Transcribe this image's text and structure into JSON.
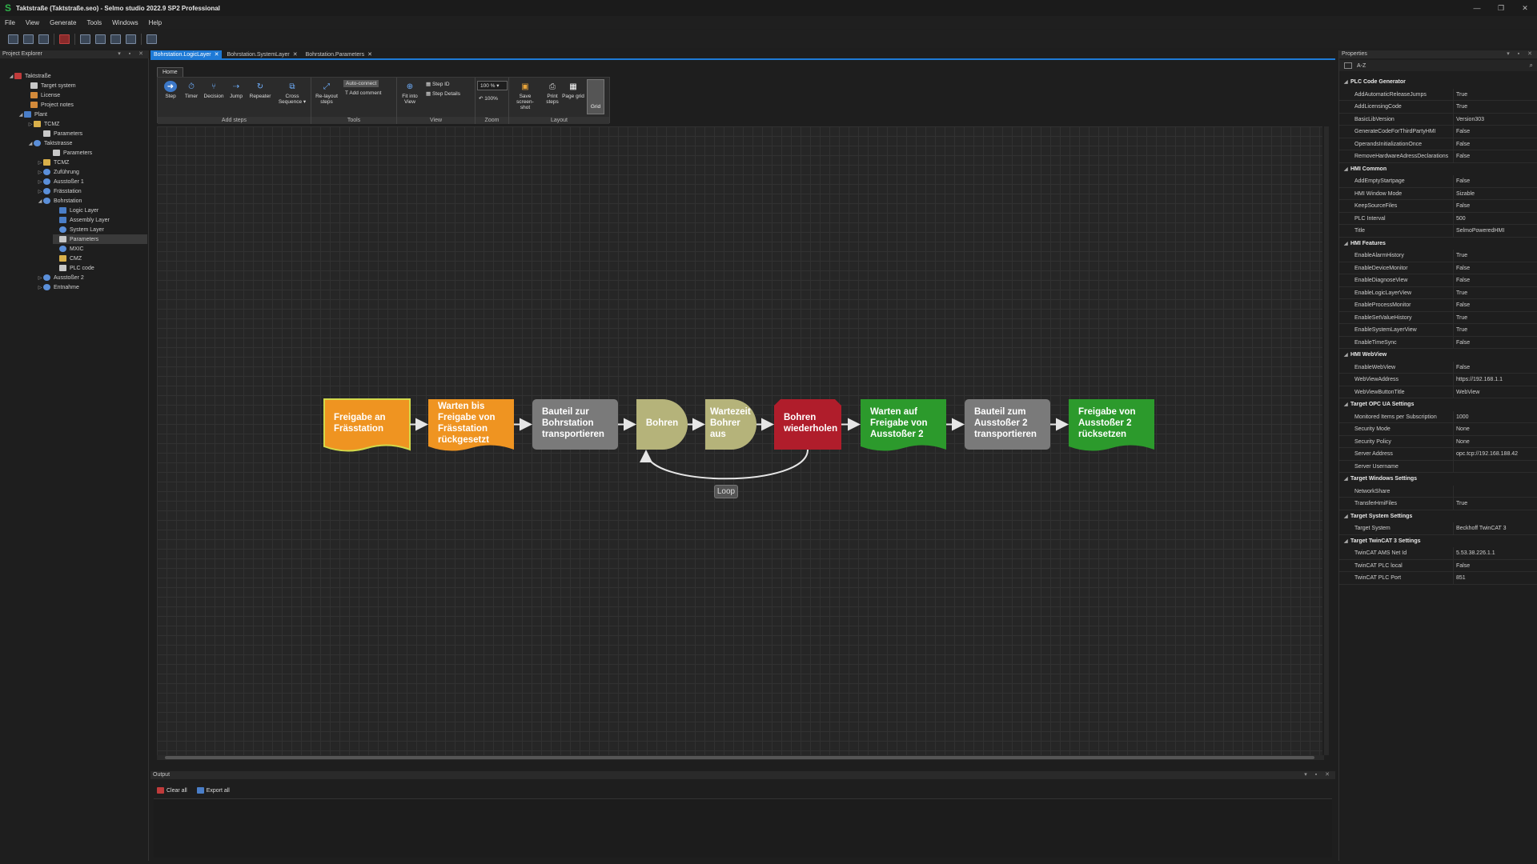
{
  "window": {
    "title": "Taktstraße (Taktstraße.seo) - Selmo studio 2022.9 SP2 Professional",
    "logo": "S",
    "buttons": [
      "—",
      "❐",
      "✕"
    ]
  },
  "menu": [
    "File",
    "View",
    "Generate",
    "Tools",
    "Windows",
    "Help"
  ],
  "explorer": {
    "title": "Project Explorer",
    "items": [
      {
        "label": "Taktstraße",
        "arrow": "◢",
        "icon": "red"
      },
      {
        "label": "Target system",
        "arrow": "",
        "icon": "doc"
      },
      {
        "label": "License",
        "arrow": "",
        "icon": "orange"
      },
      {
        "label": "Project notes",
        "arrow": "",
        "icon": "orange"
      },
      {
        "label": "Plant",
        "arrow": "◢",
        "icon": "blue"
      },
      {
        "label": "TCMZ",
        "arrow": "▷",
        "icon": "folder"
      },
      {
        "label": "Parameters",
        "arrow": "",
        "icon": "doc"
      },
      {
        "label": "Taktstrasse",
        "arrow": "◢",
        "icon": "globe"
      },
      {
        "label": "Parameters",
        "arrow": "",
        "icon": "doc"
      },
      {
        "label": "TCMZ",
        "arrow": "▷",
        "icon": "folder"
      },
      {
        "label": "Zuführung",
        "arrow": "▷",
        "icon": "globe"
      },
      {
        "label": "Ausstoßer 1",
        "arrow": "▷",
        "icon": "globe"
      },
      {
        "label": "Frässtation",
        "arrow": "▷",
        "icon": "globe"
      },
      {
        "label": "Bohrstation",
        "arrow": "◢",
        "icon": "globe"
      },
      {
        "label": "Logic Layer",
        "arrow": "",
        "icon": "blue"
      },
      {
        "label": "Assembly Layer",
        "arrow": "",
        "icon": "blue"
      },
      {
        "label": "System Layer",
        "arrow": "",
        "icon": "globe"
      },
      {
        "label": "Parameters",
        "arrow": "",
        "icon": "doc"
      },
      {
        "label": "MXIC",
        "arrow": "",
        "icon": "globe"
      },
      {
        "label": "CMZ",
        "arrow": "",
        "icon": "folder"
      },
      {
        "label": "PLC code",
        "arrow": "",
        "icon": "doc"
      },
      {
        "label": "Ausstoßer 2",
        "arrow": "▷",
        "icon": "globe"
      },
      {
        "label": "Entnahme",
        "arrow": "▷",
        "icon": "globe"
      }
    ]
  },
  "tabs": [
    {
      "label": "Bohrstation.LogicLayer",
      "active": true
    },
    {
      "label": "Bohrstation.SystemLayer",
      "active": false
    },
    {
      "label": "Bohrstation.Parameters",
      "active": false
    }
  ],
  "ribbon": {
    "tab": "Home",
    "add_steps": {
      "group": "Add steps",
      "step": "Step",
      "timer": "Timer",
      "decision": "Decision",
      "jump": "Jump",
      "repeater": "Repeater",
      "cross_sequence": "Cross Sequence ▾"
    },
    "tools": {
      "group": "Tools",
      "relayout": "Re-layout steps",
      "auto_connect": "Auto-connect",
      "add_comment": "Add comment"
    },
    "view": {
      "group": "View",
      "fit": "Fit into View",
      "step_id": "Step ID",
      "step_details": "Step Details"
    },
    "zoom": {
      "group": "Zoom",
      "value": "100 %",
      "reset": "100%"
    },
    "layout": {
      "group": "Layout",
      "save": "Save screen-shot",
      "print": "Print steps",
      "page": "Page grid",
      "grid": "Grid"
    }
  },
  "flow": {
    "steps": [
      {
        "label": "Freigabe an\nFrässtation",
        "color": "#ef9421",
        "shape": "doc",
        "border": "#d2d94a"
      },
      {
        "label": "Warten bis\nFreigabe von\nFrässtation\nrückgesetzt",
        "color": "#ef9421",
        "shape": "doc",
        "border": ""
      },
      {
        "label": "Bauteil zur\nBohrstation\ntransportieren",
        "color": "#7a7a7a",
        "shape": "rounded",
        "border": ""
      },
      {
        "label": "Bohren",
        "color": "#b5b37a",
        "shape": "half-round",
        "border": ""
      },
      {
        "label": "Wartezeit\nBohrer\naus",
        "color": "#b5b37a",
        "shape": "half-round",
        "border": ""
      },
      {
        "label": "Bohren\nwiederholen",
        "color": "#b01d2b",
        "shape": "octagon",
        "border": ""
      },
      {
        "label": "Warten auf\nFreigabe von\nAusstoßer 2",
        "color": "#2c9a2c",
        "shape": "doc",
        "border": ""
      },
      {
        "label": "Bauteil zum\nAusstoßer 2\ntransportieren",
        "color": "#7a7a7a",
        "shape": "rounded",
        "border": ""
      },
      {
        "label": "Freigabe von\nAusstoßer 2\nrücksetzen",
        "color": "#2c9a2c",
        "shape": "doc",
        "border": ""
      }
    ],
    "loop_label": "Loop"
  },
  "output": {
    "title": "Output",
    "clear_all": "Clear all",
    "export_all": "Export all"
  },
  "properties": {
    "title": "Properties",
    "sort_label": "A-Z",
    "sections": [
      {
        "name": "PLC Code Generator",
        "rows": [
          [
            "AddAutomaticReleaseJumps",
            "True"
          ],
          [
            "AddLicensingCode",
            "True"
          ],
          [
            "BasicLibVersion",
            "Version303"
          ],
          [
            "GenerateCodeForThirdPartyHMI",
            "False"
          ],
          [
            "OperandsInitializationOnce",
            "False"
          ],
          [
            "RemoveHardwareAdressDeclarations",
            "False"
          ]
        ]
      },
      {
        "name": "HMI Common",
        "rows": [
          [
            "AddEmptyStartpage",
            "False"
          ],
          [
            "HMI Window Mode",
            "Sizable"
          ],
          [
            "KeepSourceFiles",
            "False"
          ],
          [
            "PLC Interval",
            "500"
          ],
          [
            "Title",
            "SelmoPoweredHMI"
          ]
        ]
      },
      {
        "name": "HMI Features",
        "rows": [
          [
            "EnableAlarmHistory",
            "True"
          ],
          [
            "EnableDeviceMonitor",
            "False"
          ],
          [
            "EnableDiagnoseView",
            "False"
          ],
          [
            "EnableLogicLayerView",
            "True"
          ],
          [
            "EnableProcessMonitor",
            "False"
          ],
          [
            "EnableSetValueHistory",
            "True"
          ],
          [
            "EnableSystemLayerView",
            "True"
          ],
          [
            "EnableTimeSync",
            "False"
          ]
        ]
      },
      {
        "name": "HMI WebView",
        "rows": [
          [
            "EnableWebView",
            "False"
          ],
          [
            "WebViewAddress",
            "https://192.168.1.1"
          ],
          [
            "WebViewButtonTitle",
            "WebView"
          ]
        ]
      },
      {
        "name": "Target OPC UA Settings",
        "rows": [
          [
            "Monitored Items per Subscription",
            "1000"
          ],
          [
            "Security Mode",
            "None"
          ],
          [
            "Security Policy",
            "None"
          ],
          [
            "Server Address",
            "opc.tcp://192.168.188.42"
          ],
          [
            "Server Username",
            ""
          ]
        ]
      },
      {
        "name": "Target Windows Settings",
        "rows": [
          [
            "NetworkShare",
            ""
          ],
          [
            "TransferHmiFiles",
            "True"
          ]
        ]
      },
      {
        "name": "Target System Settings",
        "rows": [
          [
            "Target System",
            "Beckhoff TwinCAT 3"
          ]
        ]
      },
      {
        "name": "Target TwinCAT 3 Settings",
        "rows": [
          [
            "TwinCAT AMS Net Id",
            "5.53.38.226.1.1"
          ],
          [
            "TwinCAT PLC local",
            "False"
          ],
          [
            "TwinCAT PLC Port",
            "851"
          ]
        ]
      }
    ]
  }
}
